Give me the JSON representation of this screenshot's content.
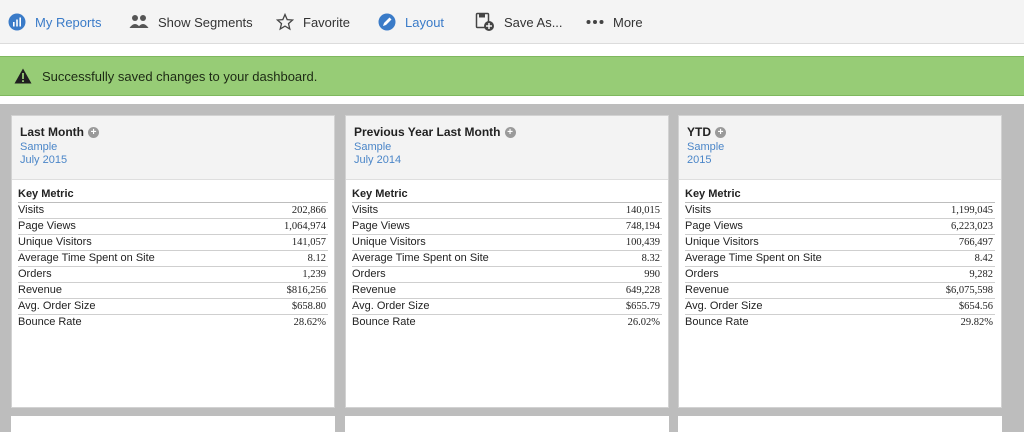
{
  "toolbar": {
    "items": [
      {
        "label": "My Reports",
        "icon": "reports-icon"
      },
      {
        "label": "Show Segments",
        "icon": "segments-icon"
      },
      {
        "label": "Favorite",
        "icon": "star-icon"
      },
      {
        "label": "Layout",
        "icon": "layout-icon"
      },
      {
        "label": "Save As...",
        "icon": "save-as-icon"
      },
      {
        "label": "More",
        "icon": "more-icon"
      }
    ]
  },
  "notification": {
    "icon": "warning-icon",
    "message": "Successfully saved changes to your dashboard."
  },
  "cards": [
    {
      "title": "Last Month",
      "segment": "Sample",
      "period": "July 2015",
      "metrics_header": "Key Metric",
      "metrics": [
        {
          "label": "Visits",
          "value": "202,866"
        },
        {
          "label": "Page Views",
          "value": "1,064,974"
        },
        {
          "label": "Unique Visitors",
          "value": "141,057"
        },
        {
          "label": "Average Time Spent on Site",
          "value": "8.12"
        },
        {
          "label": "Orders",
          "value": "1,239"
        },
        {
          "label": "Revenue",
          "value": "$816,256"
        },
        {
          "label": "Avg. Order Size",
          "value": "$658.80"
        },
        {
          "label": "Bounce Rate",
          "value": "28.62%"
        }
      ]
    },
    {
      "title": "Previous Year Last Month",
      "segment": "Sample",
      "period": "July 2014",
      "metrics_header": "Key Metric",
      "metrics": [
        {
          "label": "Visits",
          "value": "140,015"
        },
        {
          "label": "Page Views",
          "value": "748,194"
        },
        {
          "label": "Unique Visitors",
          "value": "100,439"
        },
        {
          "label": "Average Time Spent on Site",
          "value": "8.32"
        },
        {
          "label": "Orders",
          "value": "990"
        },
        {
          "label": "Revenue",
          "value": "649,228"
        },
        {
          "label": "Avg. Order Size",
          "value": "$655.79"
        },
        {
          "label": "Bounce Rate",
          "value": "26.02%"
        }
      ]
    },
    {
      "title": "YTD",
      "segment": "Sample",
      "period": "2015",
      "metrics_header": "Key Metric",
      "metrics": [
        {
          "label": "Visits",
          "value": "1,199,045"
        },
        {
          "label": "Page Views",
          "value": "6,223,023"
        },
        {
          "label": "Unique Visitors",
          "value": "766,497"
        },
        {
          "label": "Average Time Spent on Site",
          "value": "8.42"
        },
        {
          "label": "Orders",
          "value": "9,282"
        },
        {
          "label": "Revenue",
          "value": "$6,075,598"
        },
        {
          "label": "Avg. Order Size",
          "value": "$654.56"
        },
        {
          "label": "Bounce Rate",
          "value": "29.82%"
        }
      ]
    }
  ],
  "colors": {
    "accent": "#3a7bc8",
    "success_bar": "#97cc76",
    "dashboard_bg": "#bdbdbd"
  }
}
